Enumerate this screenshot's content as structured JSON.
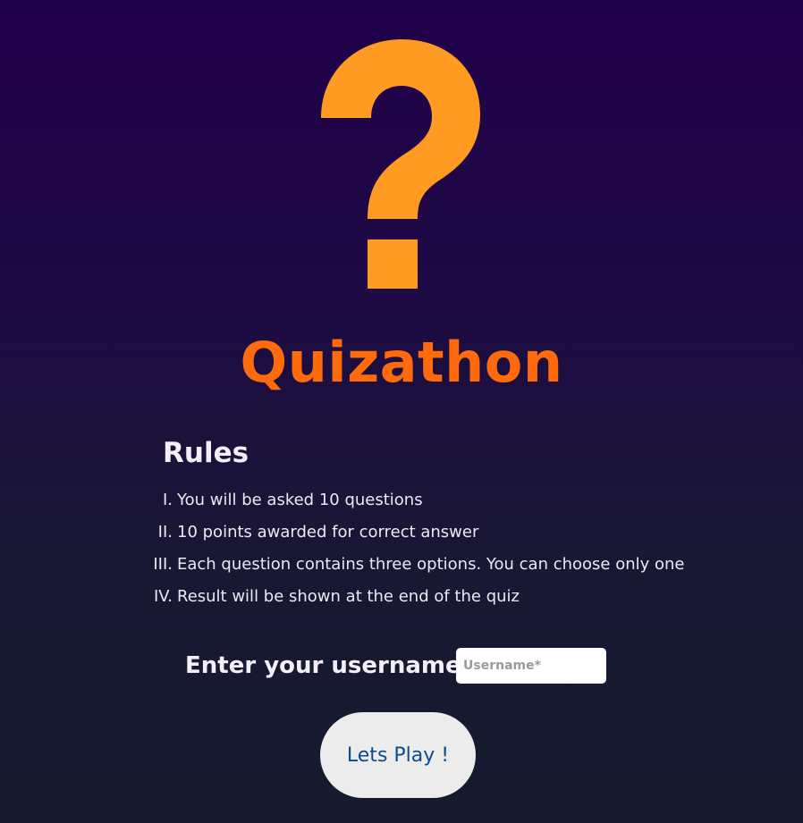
{
  "logo": {
    "icon": "question-mark-icon",
    "color": "#ff9a22"
  },
  "app": {
    "title": "Quizathon",
    "title_color": "#ff6a0c"
  },
  "rules": {
    "heading": "Rules",
    "items": [
      {
        "num": "I.",
        "text": "You will be asked 10 questions"
      },
      {
        "num": "II.",
        "text": "10 points awarded for correct answer"
      },
      {
        "num": "III.",
        "text": "Each question contains three options. You can choose only one"
      },
      {
        "num": "IV.",
        "text": "Result will be shown at the end of the quiz"
      }
    ]
  },
  "username": {
    "label": "Enter your username",
    "placeholder": "Username*",
    "value": ""
  },
  "play_button": {
    "label": "Lets Play !",
    "text_color": "#0a4c8c"
  }
}
